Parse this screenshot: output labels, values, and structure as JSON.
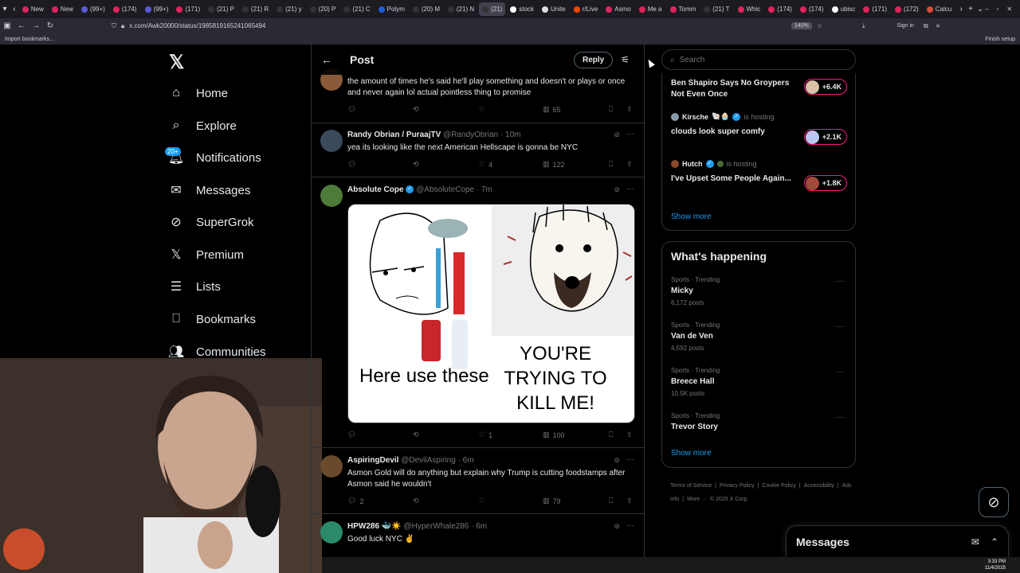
{
  "browser": {
    "tabs": [
      "New",
      "New",
      "(99+)",
      "(174)",
      "(99+)",
      "(171)",
      "(21) P",
      "(21) R",
      "(21) y",
      "(20) P",
      "(21) C",
      "Polym",
      "(20) M",
      "(21) N",
      "(21)",
      "stock",
      "Unite",
      "r/Live",
      "Asmo",
      "Me a",
      "Tomm",
      "(21) T",
      "Whic",
      "(174)",
      "(174)",
      "ubisc",
      "(171)",
      "(172)",
      "Calcu"
    ],
    "active_tab_index": 14,
    "url": "x.com/Awk20000/status/1985819165241065494",
    "zoom": "140%",
    "sign_in": "Sign in",
    "bookmarks_import": "Import bookmarks...",
    "finish_setup": "Finish setup"
  },
  "nav": {
    "items": [
      {
        "label": "Home",
        "icon": "home-icon"
      },
      {
        "label": "Explore",
        "icon": "search-icon"
      },
      {
        "label": "Notifications",
        "icon": "bell-icon"
      },
      {
        "label": "Messages",
        "icon": "mail-icon"
      },
      {
        "label": "SuperGrok",
        "icon": "grok-icon"
      },
      {
        "label": "Premium",
        "icon": "x-icon"
      },
      {
        "label": "Lists",
        "icon": "list-icon"
      },
      {
        "label": "Bookmarks",
        "icon": "bookmark-icon"
      },
      {
        "label": "Communities",
        "icon": "people-icon"
      }
    ],
    "notif_badge": "20+"
  },
  "header": {
    "title": "Post",
    "reply_button": "Reply"
  },
  "tweets": [
    {
      "text": "the amount of times he's said he'll play something and doesn't or plays or once and never again lol actual pointless thing to promise",
      "replies": "",
      "retweets": "",
      "likes": "",
      "views": "65"
    },
    {
      "name": "Randy Obrian / PuraajTV",
      "handle": "@RandyObrian",
      "time": "· 10m",
      "text": "yea its looking like the next American Hellscape is gonna be NYC",
      "replies": "",
      "retweets": "",
      "likes": "4",
      "views": "122"
    },
    {
      "name": "Absolute Cope",
      "handle": "@AbsoluteCope",
      "time": "· 7m",
      "meme_left": "Here use these",
      "meme_right": "YOU'RE TRYING TO KILL ME!",
      "replies": "",
      "retweets": "",
      "likes": "1",
      "views": "100"
    },
    {
      "name": "AspiringDevil",
      "handle": "@DevilAspiring",
      "time": "· 6m",
      "text": "Asmon Gold will do anything but explain why Trump is cutting foodstamps after Asmon said he wouldn't",
      "replies": "2",
      "retweets": "",
      "likes": "",
      "views": "79"
    },
    {
      "name": "HPW286",
      "name_emoji": "🐳☀️",
      "handle": "@HyperWhale286",
      "time": "· 6m",
      "text": "Good luck NYC ✌️"
    }
  ],
  "search": {
    "placeholder": "Search"
  },
  "spaces": [
    {
      "title": "Ben Shapiro Says No Groypers Not Even Once",
      "count": "+6.4K"
    },
    {
      "host": "Kirsche",
      "host_emoji": "🐚🧁",
      "hosting": "is hosting",
      "title": "clouds look super comfy",
      "count": "+2.1K"
    },
    {
      "host": "Hutch",
      "host_emoji": "",
      "hosting": "is hosting",
      "title": "I've Upset Some People Again...",
      "count": "+1.8K"
    }
  ],
  "spaces_show_more": "Show more",
  "whats_happening": {
    "title": "What's happening",
    "trends": [
      {
        "category": "Sports · Trending",
        "name": "Micky",
        "posts": "6,172 posts"
      },
      {
        "category": "Sports · Trending",
        "name": "Van de Ven",
        "posts": "4,592 posts"
      },
      {
        "category": "Sports · Trending",
        "name": "Breece Hall",
        "posts": "10.5K posts"
      },
      {
        "category": "Sports · Trending",
        "name": "Trevor Story",
        "posts": ""
      }
    ],
    "show_more": "Show more"
  },
  "footer": {
    "links": [
      "Terms of Service",
      "|",
      "Privacy Policy",
      "|",
      "Cookie Policy",
      "|",
      "Accessibility",
      "|",
      "Ads info",
      "|",
      "More ···",
      "© 2025 X Corp."
    ]
  },
  "messages_drawer": {
    "title": "Messages"
  },
  "taskbar": {
    "time": "3:33 PM",
    "date": "11/4/2025"
  },
  "colors": {
    "accent": "#1d9bf0",
    "live_pink": "#f91880",
    "border": "#2f3336",
    "muted": "#71767b"
  }
}
